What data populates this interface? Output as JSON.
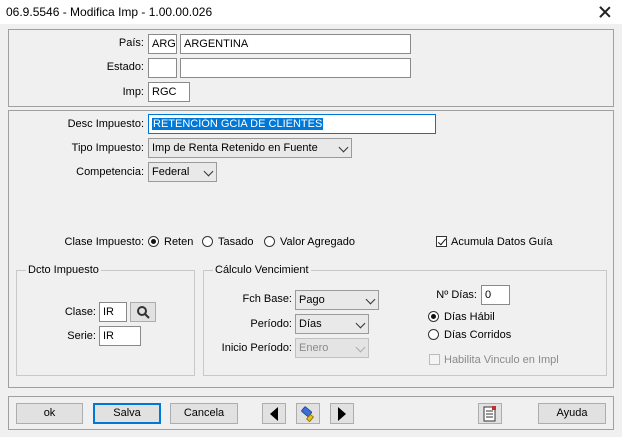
{
  "window": {
    "title": "06.9.5546 - Modifica Imp - 1.00.00.026"
  },
  "header": {
    "pais_label": "País:",
    "pais_code": "ARG",
    "pais_name": "ARGENTINA",
    "estado_label": "Estado:",
    "estado_code": "",
    "estado_name": "",
    "imp_label": "Imp:",
    "imp_value": "RGC"
  },
  "details": {
    "desc_label": "Desc Impuesto:",
    "desc_value": "RETENCIÓN GCIA DE CLIENTES",
    "tipo_label": "Tipo Impuesto:",
    "tipo_value": "Imp de Renta Retenido en Fuente",
    "competencia_label": "Competencia:",
    "competencia_value": "Federal",
    "clase_label": "Clase Impuesto:",
    "clase_options": [
      "Reten",
      "Tasado",
      "Valor Agregado"
    ],
    "clase_selected": "Reten",
    "acumula_label": "Acumula Datos Guía",
    "acumula_checked": true
  },
  "dcto": {
    "title": "Dcto Impuesto",
    "clase_label": "Clase:",
    "clase_value": "IR",
    "serie_label": "Serie:",
    "serie_value": "IR"
  },
  "calculo": {
    "title": "Cálculo Vencimient",
    "fch_base_label": "Fch Base:",
    "fch_base_value": "Pago",
    "periodo_label": "Período:",
    "periodo_value": "Días",
    "inicio_label": "Inicio Período:",
    "inicio_value": "Enero",
    "ndias_label": "Nº Días:",
    "ndias_value": "0",
    "dias_habil_label": "Días Hábil",
    "dias_corridos_label": "Días Corridos",
    "dias_selected": "Días Hábil",
    "habilita_label": "Habilita Vinculo en Impl"
  },
  "footer": {
    "ok_label": "ok",
    "salva_label": "Salva",
    "cancela_label": "Cancela",
    "ayuda_label": "Ayuda"
  },
  "colors": {
    "accent": "#0078d7",
    "background": "#f0f0f0"
  }
}
